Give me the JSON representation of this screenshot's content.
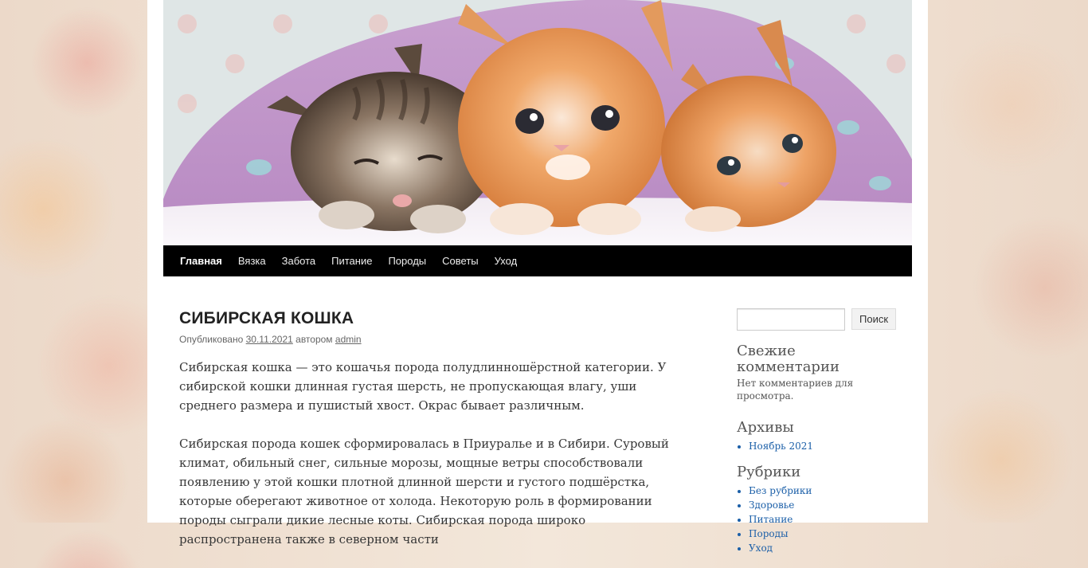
{
  "nav": {
    "items": [
      {
        "label": "Главная",
        "current": true
      },
      {
        "label": "Вязка",
        "current": false
      },
      {
        "label": "Забота",
        "current": false
      },
      {
        "label": "Питание",
        "current": false
      },
      {
        "label": "Породы",
        "current": false
      },
      {
        "label": "Советы",
        "current": false
      },
      {
        "label": "Уход",
        "current": false
      }
    ]
  },
  "post": {
    "title": "СИБИРСКАЯ КОШКА",
    "meta_prefix": "Опубликовано",
    "date": "30.11.2021",
    "meta_by": "автором",
    "author": "admin",
    "paragraphs": [
      "Сибирская кошка — это кошачья порода полудлинношёрстной категории. У сибирской кошки длинная густая шерсть, не пропускающая влагу, уши среднего размера и пушистый хвост. Окрас бывает различным.",
      "Сибирская порода кошек сформировалась в Приуралье и в Сибири. Суровый климат, обильный снег, сильные морозы, мощные ветры способствовали появлению у этой кошки плотной длинной шерсти и густого подшёрстка, которые оберегают животное от холода. Некоторую роль в формировании породы сыграли дикие лесные коты. Сибирская порода широко распространена также в северном части"
    ]
  },
  "sidebar": {
    "search_button": "Поиск",
    "search_value": "",
    "recent_comments": {
      "title": "Свежие комментарии",
      "text": "Нет комментариев для просмотра."
    },
    "archives": {
      "title": "Архивы",
      "items": [
        "Ноябрь 2021"
      ]
    },
    "categories": {
      "title": "Рубрики",
      "items": [
        "Без рубрики",
        "Здоровье",
        "Питание",
        "Породы",
        "Уход"
      ]
    }
  },
  "colors": {
    "nav_bg": "#000000",
    "link": "#1b5fa8",
    "title": "#222222"
  },
  "header_image": {
    "icon": "kittens-photo"
  }
}
